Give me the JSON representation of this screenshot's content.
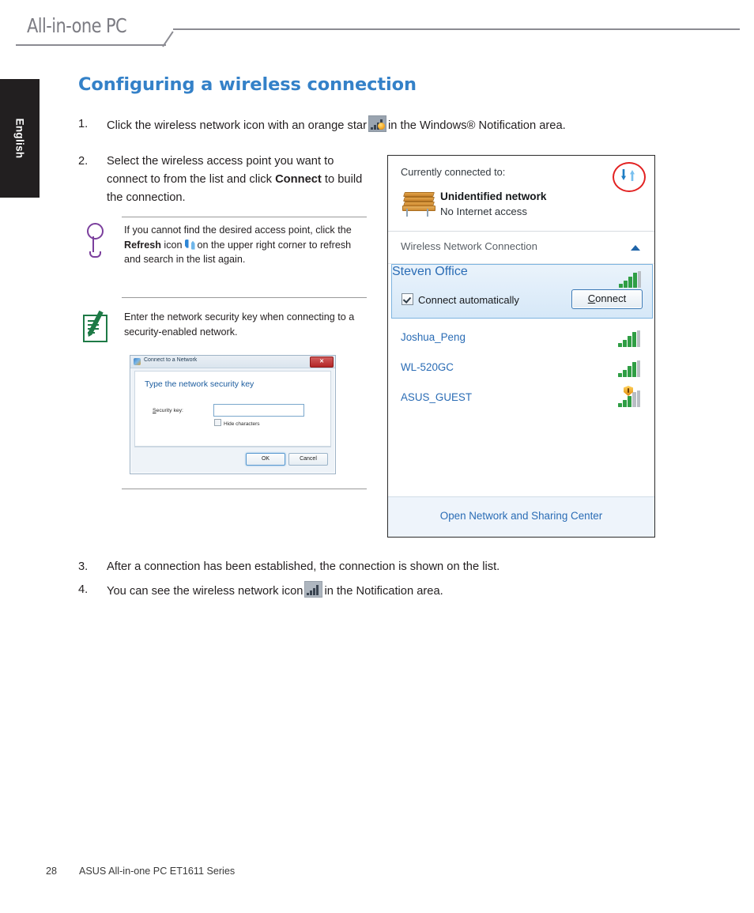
{
  "header": {
    "product": "All-in-one PC"
  },
  "sidebar": {
    "language_tab": "English"
  },
  "page": {
    "title": "Configuring a wireless connection"
  },
  "steps": [
    {
      "num": "1.",
      "pre": "Click the wireless network icon with an orange star",
      "post": "in the Windows® Notification area.",
      "icon": "wifi-orange-star-icon"
    },
    {
      "num": "2.",
      "line1": "Select the wireless access point you",
      "line2": "want to connect to from the list and click",
      "bold": "Connect",
      "line3": "to build the connection."
    },
    {
      "num": "3.",
      "text": "After a connection has been established, the connection is shown on the list."
    },
    {
      "num": "4.",
      "pre": "You can see the wireless network icon",
      "post": "in the Notification area.",
      "icon": "wifi-bars-icon"
    }
  ],
  "tip": {
    "icon": "tip-magnifier-icon",
    "line1": "If you cannot find the desired access point,",
    "line2_pre": "click the",
    "line2_bold": "Refresh",
    "line2_mid": "icon",
    "line2_post": "on the upper",
    "line3": "right corner to refresh and search in the",
    "line4": "list again."
  },
  "note": {
    "icon": "note-pad-icon",
    "line1": "Enter the network security key when",
    "line2": "connecting to a security-enabled network."
  },
  "security_dialog": {
    "title": "Connect to a Network",
    "close_label": "✕",
    "heading": "Type the network security key",
    "field_label": "Security key:",
    "field_value": "",
    "hide_characters": "Hide characters",
    "ok": "OK",
    "cancel": "Cancel"
  },
  "network_panel": {
    "currently_connected_label": "Currently connected to:",
    "refresh_icon": "refresh-icon",
    "current_network": {
      "name": "Unidentified network",
      "status": "No Internet access",
      "icon": "bench-icon"
    },
    "connection_group": {
      "title": "Wireless Network Connection",
      "chevron": "chevron-up-icon"
    },
    "selected_network": {
      "ssid": "Steven Office",
      "signal": 4,
      "connect_automatically": "Connect automatically",
      "connect_automatically_checked": true,
      "connect_button": "Connect"
    },
    "networks": [
      {
        "ssid": "Joshua_Peng",
        "signal": 4,
        "secured_warning": false
      },
      {
        "ssid": "WL-520GC",
        "signal": 4,
        "secured_warning": false
      },
      {
        "ssid": "ASUS_GUEST",
        "signal": 3,
        "secured_warning": true
      }
    ],
    "footer_link": "Open Network and Sharing Center"
  },
  "footer": {
    "page_number": "28",
    "doc_title": "ASUS All-in-one PC ET1611 Series"
  },
  "colors": {
    "title_blue": "#3481c8",
    "link_blue": "#2a6cb5",
    "annotation_red": "#e22121",
    "signal_green": "#2f9e44"
  }
}
